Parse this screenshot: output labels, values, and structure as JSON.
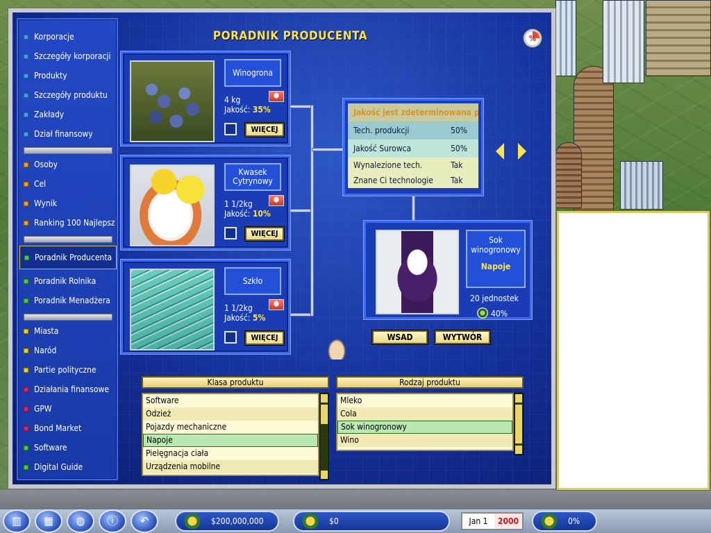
{
  "window": {
    "title": "PORADNIK PRODUCENTA",
    "pie_icon_symbol": "%"
  },
  "sidebar": {
    "items": [
      {
        "label": "Korporacje",
        "color": "#3aa0ff"
      },
      {
        "label": "Szczegóły korporacji",
        "color": "#3aa0ff"
      },
      {
        "label": "Produkty",
        "color": "#3aa0ff"
      },
      {
        "label": "Szczegóły produktu",
        "color": "#3aa0ff"
      },
      {
        "label": "Zakłady",
        "color": "#3aa0ff"
      },
      {
        "label": "Dział finansowy",
        "color": "#3aa0ff"
      },
      {
        "label": "Osoby",
        "color": "#f0a020"
      },
      {
        "label": "Cel",
        "color": "#f0a020"
      },
      {
        "label": "Wynik",
        "color": "#f0a020"
      },
      {
        "label": "Ranking 100 Najlepsz",
        "color": "#f0a020"
      },
      {
        "label": "Poradnik Producenta",
        "color": "#3fcf3f"
      },
      {
        "label": "Poradnik Rolnika",
        "color": "#3fcf3f"
      },
      {
        "label": "Poradnik Menadżera",
        "color": "#3fcf3f"
      },
      {
        "label": "Miasta",
        "color": "#f0d020"
      },
      {
        "label": "Naród",
        "color": "#f0d020"
      },
      {
        "label": "Partie polityczne",
        "color": "#f0d020"
      },
      {
        "label": "Działania finansowe",
        "color": "#e0207a"
      },
      {
        "label": "GPW",
        "color": "#e0207a"
      },
      {
        "label": "Bond Market",
        "color": "#e0207a"
      },
      {
        "label": "Software",
        "color": "#3fcf3f"
      },
      {
        "label": "Digital Guide",
        "color": "#3fcf3f"
      }
    ]
  },
  "ingredients": [
    {
      "name": "Winogrona",
      "amount": "4 kg",
      "quality_label": "Jakość:",
      "quality": "35%",
      "more_label": "WIĘCEJ",
      "photo": "grapes-photo"
    },
    {
      "name": "Kwasek Cytrynowy",
      "amount": "1 1/2kg",
      "quality_label": "Jakość:",
      "quality": "10%",
      "more_label": "WIĘCEJ",
      "photo": "citric-acid-photo"
    },
    {
      "name": "Szkło",
      "amount": "1 1/2kg",
      "quality_label": "Jakość:",
      "quality": "5%",
      "more_label": "WIĘCEJ",
      "photo": "glass-photo"
    }
  ],
  "determinants": {
    "header": "Jakość jest zdeterminowana prze:",
    "rows": [
      {
        "key": "Tech. produkcji",
        "value": "50%"
      },
      {
        "key": "Jakość Surowca",
        "value": "50%"
      },
      {
        "key": "Wynalezione tech.",
        "value": "Tak"
      },
      {
        "key": "Znane Ci technologie",
        "value": "Tak"
      }
    ]
  },
  "product": {
    "name": "Sok winogronowy",
    "category": "Napoje",
    "units": "20 jednostek",
    "quality": "40%"
  },
  "buttons": {
    "input": "WSAD",
    "output": "WYTWÓR"
  },
  "product_class": {
    "header": "Klasa produktu",
    "items": [
      "Software",
      "Odzież",
      "Pojazdy mechaniczne",
      "Napoje",
      "Pielęgnacja ciała",
      "Urządzenia mobilne"
    ],
    "selected_index": 3
  },
  "product_type": {
    "header": "Rodzaj produktu",
    "items": [
      "Mleko",
      "Cola",
      "Sok winogronowy",
      "Wino"
    ],
    "selected_index": 2
  },
  "status_bar": {
    "cash": "$200,000,000",
    "profit": "$0",
    "date_day": "Jan 1",
    "date_year": "2000",
    "progress": "0%"
  }
}
